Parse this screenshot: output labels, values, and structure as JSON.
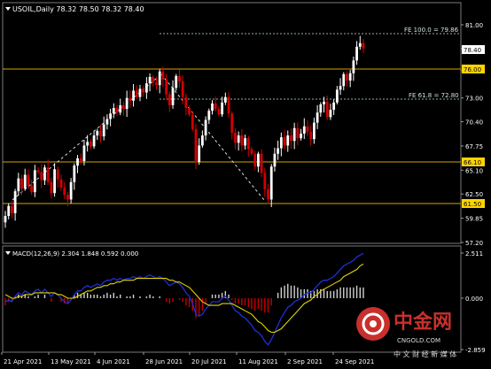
{
  "main_header": {
    "icon": "triangle-down-icon",
    "text": "USOIL,Daily  78.32 78.50 78.32 78.40"
  },
  "macd_header": {
    "icon": "triangle-down-icon",
    "text": "MACD(12,26,9) 2.304 1.848 0.592 0.000"
  },
  "price_axis": {
    "ticks": [
      "81.00",
      "78.40",
      "76.00",
      "73.00",
      "70.40",
      "67.75",
      "65.10",
      "62.50",
      "59.85",
      "57.20"
    ],
    "line_labels": [
      "76.00",
      "66.10",
      "61.50"
    ]
  },
  "macd_axis": {
    "ticks": [
      "2.511",
      "0.000",
      "-2.859"
    ]
  },
  "fib_labels": {
    "fe100": "FE 100.0 = 79.86",
    "fe618": "FE 61.8 = 72.80"
  },
  "date_axis": {
    "labels": [
      "21 Apr 2021",
      "13 May 2021",
      "4 Jun 2021",
      "28 Jun 2021",
      "20 Jul 2021",
      "11 Aug 2021",
      "2 Sep 2021",
      "24 Sep 2021"
    ]
  },
  "watermark": {
    "brand": "中金网",
    "domain": "CNGOLD.COM",
    "slogan": "中 文 财 经 新 媒 体"
  },
  "colors": {
    "background": "#000000",
    "bull_candle": "#ffffff",
    "bear_candle": "#d40000",
    "level_line": "#d4a300",
    "fib_line": "#8fb0a0",
    "macd_fast": "#1f2fd8",
    "macd_signal": "#e0d400",
    "macd_hist_pos": "#cfcfcf",
    "macd_hist_neg": "#c40000",
    "axis_label_bg": "#ffd400",
    "watermark_red": "#c9302c"
  },
  "chart_data": {
    "type": "candlestick",
    "symbol": "USOIL",
    "timeframe": "Daily",
    "last_bar": {
      "open": 78.32,
      "high": 78.5,
      "low": 78.32,
      "close": 78.4
    },
    "price_range": [
      56.0,
      81.8
    ],
    "horizontal_levels": [
      76.0,
      66.1,
      61.5
    ],
    "fib_levels": [
      {
        "label": "FE 100.0",
        "value": 79.86
      },
      {
        "label": "FE 61.8",
        "value": 72.8
      }
    ],
    "closes": [
      60.1,
      61.2,
      60.4,
      62.8,
      64.2,
      63.1,
      64.6,
      63.4,
      62.7,
      65.1,
      64.9,
      64.0,
      65.4,
      63.8,
      62.6,
      65.2,
      64.1,
      63.2,
      62.4,
      61.9,
      63.8,
      65.6,
      66.4,
      66.1,
      67.8,
      68.2,
      67.7,
      68.9,
      69.4,
      68.8,
      70.1,
      70.7,
      71.3,
      71.9,
      71.4,
      72.2,
      71.8,
      73.0,
      72.7,
      73.8,
      73.1,
      74.0,
      73.6,
      74.6,
      75.3,
      74.7,
      74.4,
      75.9,
      75.0,
      73.4,
      72.2,
      74.1,
      75.4,
      74.8,
      73.1,
      71.9,
      71.2,
      69.6,
      66.0,
      67.8,
      68.9,
      70.6,
      71.6,
      72.4,
      71.8,
      71.2,
      72.5,
      73.1,
      71.3,
      69.2,
      68.1,
      68.9,
      67.8,
      68.6,
      67.4,
      66.9,
      65.5,
      66.9,
      64.8,
      63.0,
      61.9,
      65.5,
      66.9,
      67.5,
      68.7,
      67.8,
      68.9,
      68.3,
      69.7,
      68.6,
      69.1,
      69.9,
      69.3,
      68.5,
      70.3,
      71.4,
      72.3,
      72.6,
      70.9,
      71.7,
      72.5,
      73.9,
      74.3,
      75.6,
      74.9,
      75.7,
      77.1,
      78.6,
      79.0,
      78.4
    ],
    "macd_range": [
      -2.859,
      2.511
    ],
    "macd_fast": [
      -0.2,
      -0.1,
      -0.2,
      0.1,
      0.3,
      0.2,
      0.4,
      0.3,
      0.2,
      0.4,
      0.5,
      0.3,
      0.5,
      0.3,
      0.1,
      0.3,
      0.2,
      0.0,
      -0.2,
      -0.3,
      -0.1,
      0.2,
      0.4,
      0.4,
      0.6,
      0.7,
      0.6,
      0.7,
      0.8,
      0.7,
      0.9,
      1.0,
      1.0,
      1.1,
      1.0,
      1.1,
      1.0,
      1.1,
      1.1,
      1.2,
      1.1,
      1.2,
      1.1,
      1.2,
      1.3,
      1.2,
      1.1,
      1.2,
      1.1,
      0.9,
      0.7,
      0.8,
      0.9,
      0.8,
      0.6,
      0.3,
      0.1,
      -0.3,
      -0.9,
      -1.0,
      -0.9,
      -0.6,
      -0.4,
      -0.2,
      -0.2,
      -0.2,
      0.0,
      0.1,
      -0.1,
      -0.4,
      -0.7,
      -0.8,
      -1.0,
      -1.1,
      -1.3,
      -1.5,
      -1.8,
      -1.9,
      -2.1,
      -2.4,
      -2.6,
      -2.3,
      -1.9,
      -1.5,
      -1.1,
      -0.8,
      -0.5,
      -0.4,
      -0.2,
      -0.1,
      0.0,
      0.2,
      0.3,
      0.3,
      0.5,
      0.7,
      0.9,
      1.0,
      1.0,
      1.1,
      1.2,
      1.4,
      1.6,
      1.8,
      1.9,
      2.0,
      2.1,
      2.3,
      2.4,
      2.5
    ],
    "macd_signal": [
      0.2,
      0.1,
      0.0,
      0.0,
      0.1,
      0.1,
      0.2,
      0.2,
      0.2,
      0.3,
      0.3,
      0.3,
      0.3,
      0.3,
      0.3,
      0.3,
      0.2,
      0.2,
      0.1,
      0.0,
      0.0,
      0.0,
      0.1,
      0.2,
      0.3,
      0.4,
      0.4,
      0.5,
      0.6,
      0.6,
      0.7,
      0.7,
      0.8,
      0.8,
      0.9,
      0.9,
      1.0,
      1.0,
      1.0,
      1.0,
      1.1,
      1.1,
      1.1,
      1.1,
      1.1,
      1.1,
      1.1,
      1.1,
      1.1,
      1.1,
      1.0,
      1.0,
      0.9,
      0.9,
      0.8,
      0.7,
      0.6,
      0.4,
      0.2,
      0.0,
      -0.2,
      -0.3,
      -0.4,
      -0.4,
      -0.4,
      -0.4,
      -0.3,
      -0.3,
      -0.3,
      -0.3,
      -0.4,
      -0.5,
      -0.6,
      -0.7,
      -0.8,
      -0.9,
      -1.1,
      -1.3,
      -1.4,
      -1.6,
      -1.8,
      -1.9,
      -1.9,
      -1.8,
      -1.7,
      -1.5,
      -1.3,
      -1.1,
      -0.9,
      -0.7,
      -0.5,
      -0.3,
      -0.2,
      -0.1,
      0.1,
      0.2,
      0.4,
      0.5,
      0.6,
      0.7,
      0.8,
      0.9,
      1.0,
      1.2,
      1.3,
      1.4,
      1.5,
      1.6,
      1.8,
      1.9
    ]
  }
}
